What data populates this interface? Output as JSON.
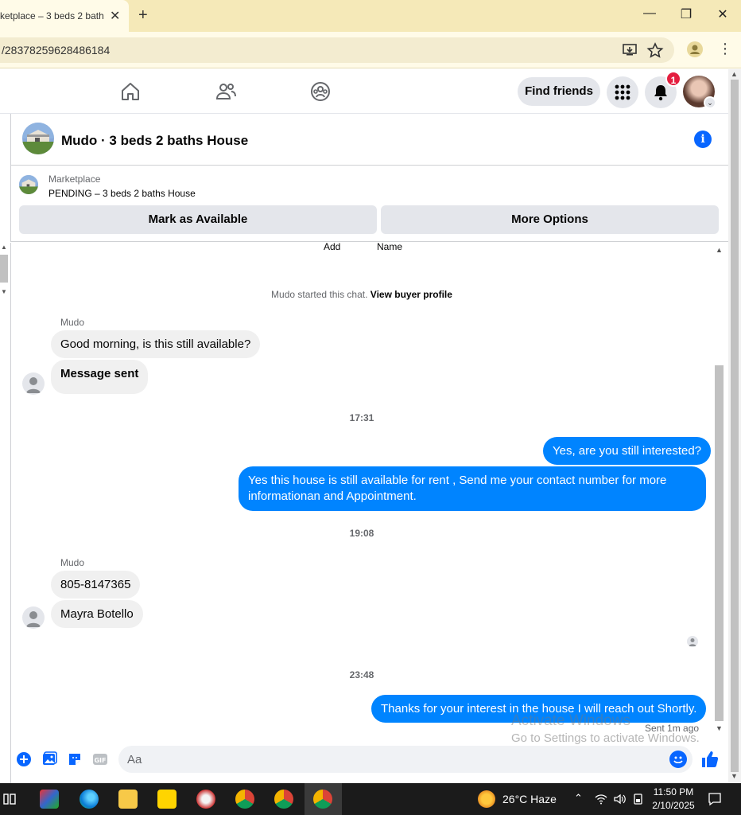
{
  "browser": {
    "tab_title": "ketplace – 3 beds 2 bath",
    "url": "/28378259628486184"
  },
  "fb_nav": {
    "find_friends": "Find friends",
    "notification_count": "1"
  },
  "chat": {
    "title": "Mudo · 3 beds 2 baths House",
    "marketplace_label": "Marketplace",
    "listing_status": "PENDING – 3 beds 2 baths House",
    "mark_available": "Mark as Available",
    "more_options": "More Options",
    "add_label": "Add",
    "name_label": "Name",
    "started_text": "Mudo started this chat.",
    "view_profile": "View buyer profile"
  },
  "messages": [
    {
      "sender": "Mudo",
      "text": "Good morning, is this still available?"
    },
    {
      "text": "Message sent"
    },
    {
      "time": "17:31"
    },
    {
      "text": "Yes, are you still interested?"
    },
    {
      "text": "Yes this house is still available for rent , Send me your contact number for more informationan and Appointment."
    },
    {
      "time": "19:08"
    },
    {
      "sender": "Mudo",
      "text": "805-8147365"
    },
    {
      "text": "Mayra Botello"
    },
    {
      "time": "23:48"
    },
    {
      "text": "Thanks for your interest in the house I will reach out Shortly."
    }
  ],
  "sent_status": "Sent 1m ago",
  "watermark": {
    "line1": "Activate Windows",
    "line2": "Go to Settings to activate Windows."
  },
  "composer": {
    "placeholder": "Aa"
  },
  "taskbar": {
    "weather": "26°C  Haze",
    "time": "11:50 PM",
    "date": "2/10/2025"
  },
  "colors": {
    "outgoing_bubble": "#0084ff",
    "incoming_bubble": "#f0f0f0",
    "accent": "#0866ff",
    "badge": "#e41e3f"
  }
}
